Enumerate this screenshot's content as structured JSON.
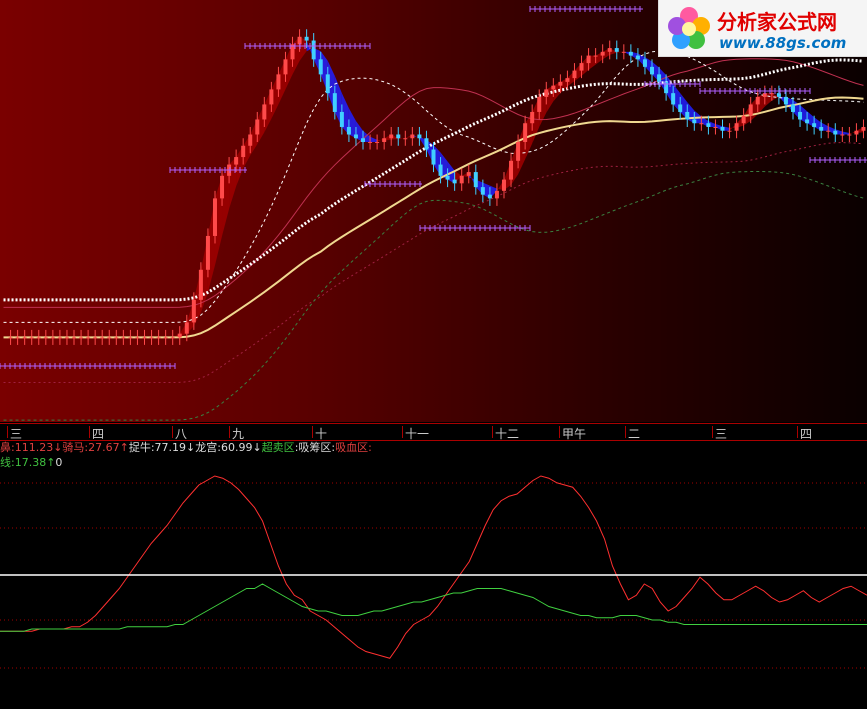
{
  "logo": {
    "title": "分析家公式网",
    "url": "www.88gs.com"
  },
  "periods": [
    "三",
    "四",
    "八",
    "九",
    "十",
    "十一",
    "十二",
    "甲午",
    "二",
    "三",
    "四"
  ],
  "legend1": [
    {
      "label": "鼻",
      "value": ":111.23",
      "arrow": "↓",
      "color": "#e04040"
    },
    {
      "label": "骑马",
      "value": ":27.67",
      "arrow": "↑",
      "color": "#e04040"
    },
    {
      "label": "捉牛",
      "value": ":77.19",
      "arrow": "↓",
      "color": "#dddddd"
    },
    {
      "label": "龙宫",
      "value": ":60.99",
      "arrow": "↓",
      "color": "#dddddd"
    },
    {
      "label": "超卖区",
      "value": "",
      "arrow": "",
      "color": "#40c040"
    },
    {
      "label": ":吸筹区",
      "value": ":",
      "arrow": "",
      "color": "#dddddd"
    },
    {
      "label": "吸血区",
      "value": ":",
      "arrow": "",
      "color": "#e04040"
    }
  ],
  "legend2": [
    {
      "label": "线",
      "value": ":17.38",
      "arrow": "↑",
      "color": "#40c040"
    },
    {
      "label": "0",
      "value": "",
      "arrow": "",
      "color": "#dddddd"
    }
  ],
  "colors": {
    "up_candle": "#ff4a4a",
    "down_candle": "#40d0ff",
    "ribbon_up": "#a00000",
    "ribbon_down": "#2020ff",
    "white_dots": "#ffffff",
    "yellow_ma": "#f0d890",
    "purple_marks": "#b060ff",
    "red_osc": "#ff3030",
    "green_osc": "#40d040",
    "zero_line": "#ffffff"
  },
  "chart_data": [
    {
      "type": "candlestick",
      "title": "",
      "x": "bar index (0-219)",
      "close": [
        20,
        20,
        20,
        20,
        20,
        20,
        20,
        20,
        20,
        20,
        20,
        20,
        20,
        20,
        20,
        20,
        20,
        20,
        20,
        20,
        20,
        20,
        20,
        20,
        20,
        21,
        24,
        30,
        38,
        47,
        57,
        63,
        66,
        68,
        71,
        74,
        78,
        82,
        86,
        90,
        94,
        98,
        100,
        99,
        94,
        90,
        85,
        80,
        76,
        74,
        73,
        72,
        72,
        72,
        73,
        74,
        73,
        73,
        74,
        73,
        70,
        66,
        63,
        62,
        61,
        63,
        64,
        60,
        58,
        57,
        59,
        62,
        67,
        72,
        77,
        80,
        84,
        86,
        87,
        88,
        89,
        91,
        93,
        95,
        95,
        96,
        97,
        96,
        96,
        95,
        94,
        92,
        90,
        88,
        85,
        82,
        80,
        78,
        77,
        77,
        76,
        76,
        75,
        75,
        77,
        79,
        82,
        84,
        85,
        85,
        84,
        82,
        80,
        78,
        77,
        76,
        75,
        75,
        74,
        74,
        74,
        75,
        76
      ],
      "notes": "K-line chart with red ribbon on rises, blue ribbon on falls, white dotted and yellow moving averages"
    },
    {
      "type": "line",
      "title": "",
      "series": [
        {
          "name": "鼻",
          "values": [
            31,
            31,
            31,
            31,
            31,
            32,
            32,
            32,
            32,
            33,
            33,
            35,
            38,
            42,
            46,
            50,
            55,
            60,
            65,
            70,
            74,
            78,
            83,
            88,
            92,
            96,
            98,
            100,
            99,
            97,
            94,
            90,
            86,
            80,
            70,
            60,
            52,
            47,
            45,
            40,
            38,
            36,
            33,
            30,
            27,
            24,
            22,
            21,
            20,
            19,
            24,
            30,
            34,
            36,
            38,
            42,
            47,
            52,
            57,
            62,
            70,
            78,
            85,
            89,
            91,
            92,
            95,
            98,
            100,
            99,
            97,
            96,
            95,
            91,
            86,
            80,
            72,
            60,
            52,
            45,
            47,
            52,
            50,
            44,
            40,
            42,
            46,
            50,
            55,
            52,
            48,
            45,
            45,
            47,
            49,
            51,
            49,
            46,
            44,
            45,
            47,
            49,
            46,
            44,
            46,
            48,
            50,
            51,
            49,
            47
          ]
        },
        {
          "name": "线",
          "values": [
            31,
            31,
            31,
            31,
            32,
            32,
            32,
            32,
            32,
            32,
            32,
            32,
            32,
            32,
            32,
            32,
            33,
            33,
            33,
            33,
            33,
            33,
            34,
            34,
            36,
            38,
            40,
            42,
            44,
            46,
            48,
            50,
            50,
            52,
            50,
            48,
            46,
            44,
            42,
            41,
            40,
            40,
            39,
            38,
            38,
            38,
            39,
            40,
            40,
            41,
            42,
            43,
            44,
            44,
            45,
            46,
            47,
            48,
            48,
            49,
            50,
            50,
            50,
            50,
            49,
            48,
            47,
            46,
            44,
            42,
            41,
            40,
            39,
            38,
            38,
            37,
            37,
            37,
            38,
            38,
            38,
            37,
            36,
            36,
            35,
            35,
            34,
            34,
            34,
            34,
            34,
            34,
            34,
            34,
            34,
            34,
            34,
            34,
            34,
            34,
            34,
            34,
            34,
            34,
            34,
            34,
            34,
            34,
            34,
            34
          ]
        }
      ],
      "zero_line": 0
    }
  ]
}
